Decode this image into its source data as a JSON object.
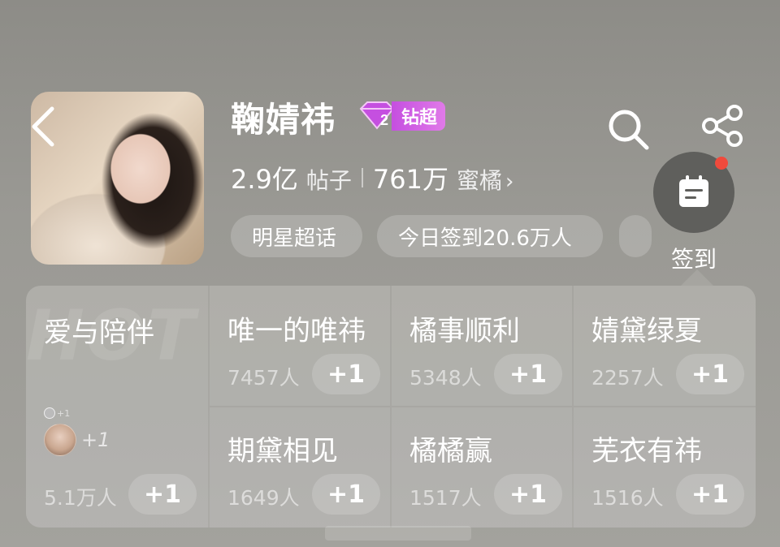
{
  "header": {
    "title": "鞠婧祎",
    "badge_level": "2",
    "badge_label": "钻超",
    "posts_count": "2.9亿",
    "posts_label": "帖子",
    "fans_count": "761万",
    "fans_label": "蜜橘",
    "fans_chevron": "›",
    "chips": [
      "明星超话",
      "今日签到20.6万人"
    ]
  },
  "checkin": {
    "label": "签到"
  },
  "featured": {
    "name": "爱与陪伴",
    "watermark": "HOT",
    "mini_plus": "+1",
    "tiny_plus": "+1",
    "count": "5.1万人",
    "button": "+1"
  },
  "groups": [
    {
      "name": "唯一的唯祎",
      "count": "7457人",
      "button": "+1"
    },
    {
      "name": "橘事顺利",
      "count": "5348人",
      "button": "+1"
    },
    {
      "name": "婧黛绿夏",
      "count": "2257人",
      "button": "+1"
    },
    {
      "name": "期黛相见",
      "count": "1649人",
      "button": "+1"
    },
    {
      "name": "橘橘赢",
      "count": "1517人",
      "button": "+1"
    },
    {
      "name": "芜衣有祎",
      "count": "1516人",
      "button": "+1"
    }
  ],
  "icons": {
    "back": "back-arrow-icon",
    "search": "search-icon",
    "share": "share-icon",
    "checkin": "calendar-icon",
    "badge": "diamond-icon"
  },
  "colors": {
    "badge_start": "#c54fe0",
    "badge_end": "#e07ae8",
    "notify_dot": "#f04a3c"
  }
}
